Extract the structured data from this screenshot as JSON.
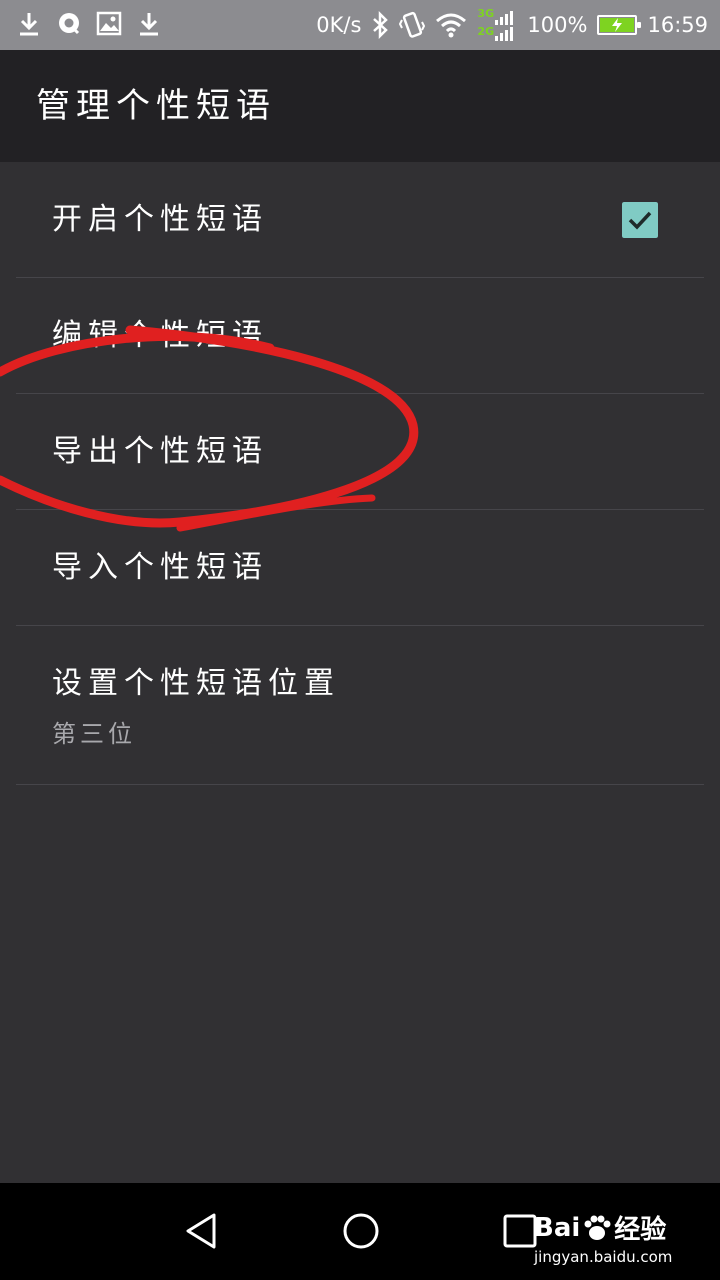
{
  "status_bar": {
    "net_speed": "0K/s",
    "battery_percent": "100%",
    "battery_level": 1.0,
    "time": "16:59",
    "left_icons": [
      "download-icon",
      "chat-icon",
      "image-icon",
      "download-icon"
    ],
    "right_icons": [
      "bluetooth-icon",
      "vibrate-icon",
      "wifi-icon",
      "signal-icon"
    ],
    "signal_labels": {
      "top": "3G",
      "bottom": "2G"
    }
  },
  "app_bar": {
    "title": "管理个性短语"
  },
  "settings": [
    {
      "label": "开启个性短语",
      "checked": true
    },
    {
      "label": "编辑个性短语"
    },
    {
      "label": "导出个性短语"
    },
    {
      "label": "导入个性短语"
    },
    {
      "label": "设置个性短语位置",
      "summary": "第三位"
    }
  ],
  "nav_bar": {
    "buttons": [
      "back-icon",
      "home-icon",
      "recents-icon"
    ]
  },
  "watermark": {
    "brand_left": "Bai",
    "brand_right": "经验",
    "url": "jingyan.baidu.com"
  },
  "colors": {
    "status_bar": "#8c8c90",
    "app_bar": "#222124",
    "background": "#313033",
    "checkbox": "#80cbc4",
    "annotation": "#e02020",
    "battery_fill": "#7ed321"
  }
}
